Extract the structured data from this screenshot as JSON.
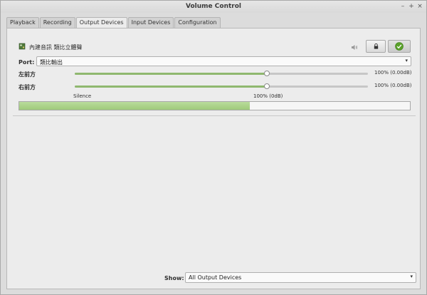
{
  "window": {
    "title": "Volume Control",
    "controls": [
      "–",
      "+",
      "×"
    ]
  },
  "tabs": [
    {
      "label": "Playback",
      "active": false
    },
    {
      "label": "Recording",
      "active": false
    },
    {
      "label": "Output Devices",
      "active": true
    },
    {
      "label": "Input Devices",
      "active": false
    },
    {
      "label": "Configuration",
      "active": false
    }
  ],
  "device": {
    "name": "內建音訊 類比立體聲",
    "port_label": "Port:",
    "port_value": "類比輸出",
    "channels": [
      {
        "name": "左前方",
        "value_text": "100% (0.00dB)",
        "level_fraction": 0.655
      },
      {
        "name": "右前方",
        "value_text": "100% (0.00dB)",
        "level_fraction": 0.655
      }
    ],
    "scale_labels": {
      "silence": "Silence",
      "hundred": "100% (0dB)"
    },
    "peak_meter_fraction": 0.59,
    "icons": {
      "device": "sound-card-icon",
      "speaker": "speaker-icon",
      "lock": "lock-icon",
      "default": "checkmark-icon"
    }
  },
  "footer": {
    "show_label": "Show:",
    "show_value": "All Output Devices"
  },
  "colors": {
    "accent_green": "#8fb86f",
    "meter_green": "#a9d183",
    "default_check": "#5aa12a"
  }
}
